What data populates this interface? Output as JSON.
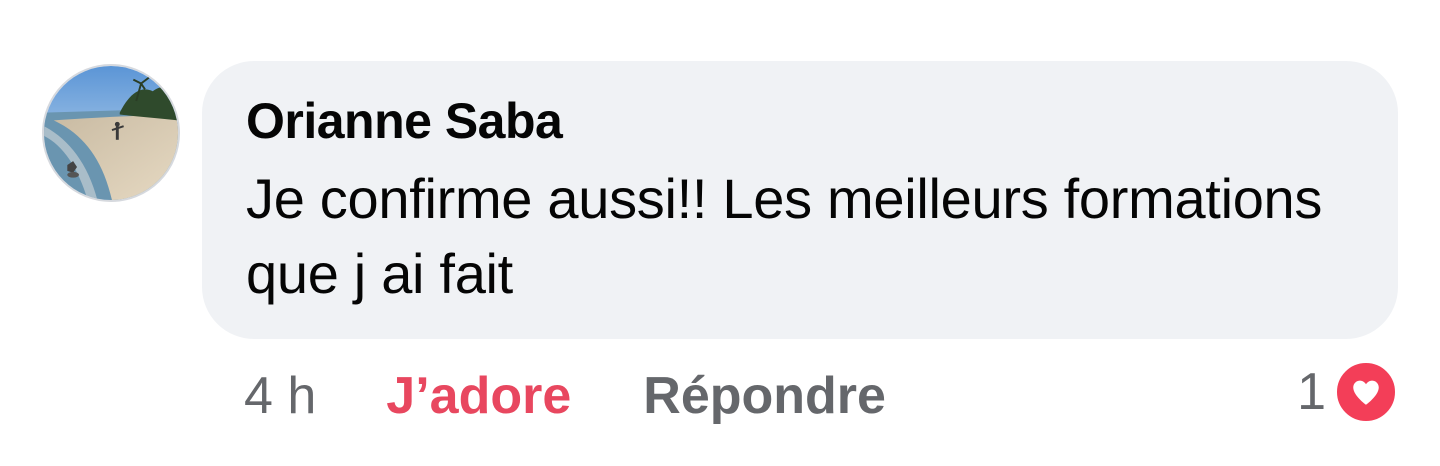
{
  "comment": {
    "author": "Orianne Saba",
    "text": "Je confirme aussi!! Les meilleurs formations que j ai fait",
    "avatar_icon": "beach-photo-avatar"
  },
  "actions": {
    "timestamp": "4 h",
    "like_label": "J’adore",
    "reply_label": "Répondre"
  },
  "reactions": {
    "count": "1",
    "icon": "heart-icon",
    "color": "#f33e58"
  },
  "colors": {
    "bubble": "#f0f2f5",
    "text": "#050505",
    "secondary": "#65676b",
    "like_active": "#e8475f"
  }
}
